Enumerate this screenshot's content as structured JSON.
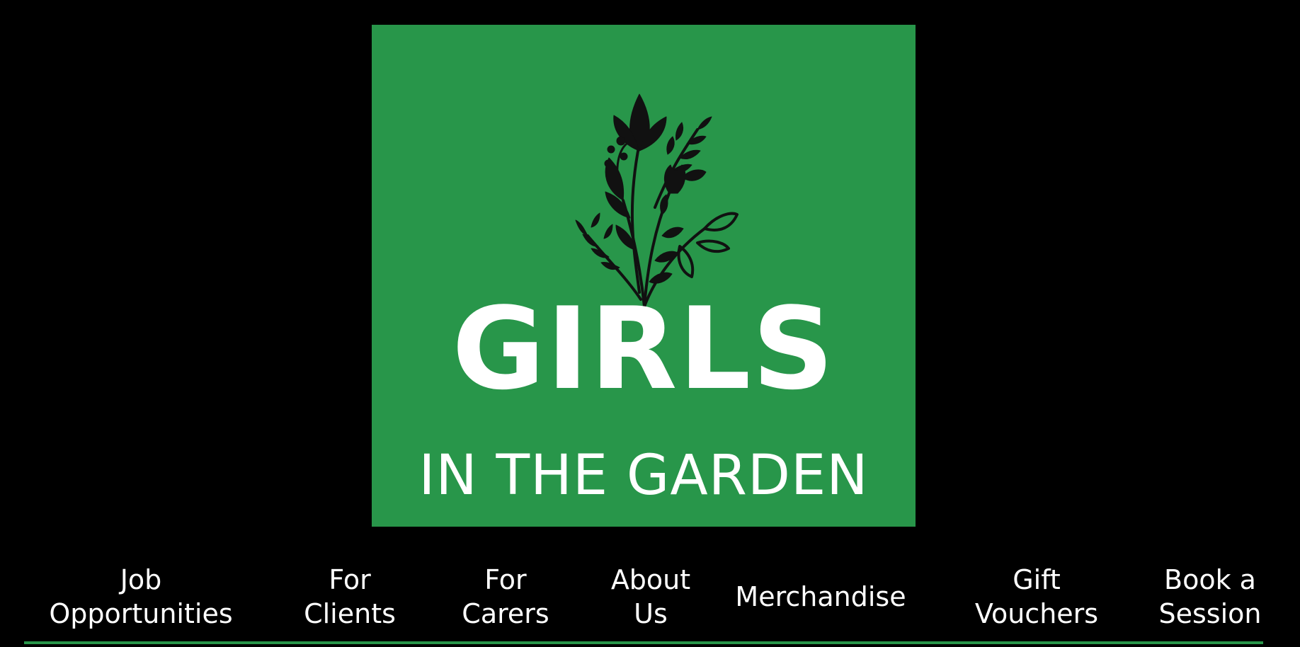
{
  "logo": {
    "title": "GIRLS",
    "subtitle": "IN THE GARDEN",
    "background_color": "#28964a",
    "icon": "plant-bouquet-icon"
  },
  "nav": {
    "items": [
      {
        "label": "Job\nOpportunities"
      },
      {
        "label": "For\nClients"
      },
      {
        "label": "For\nCarers"
      },
      {
        "label": "About\nUs"
      },
      {
        "label": "Merchandise"
      },
      {
        "label": "Gift\nVouchers"
      },
      {
        "label": "Book a\nSession"
      }
    ],
    "underline_color": "#28964a"
  }
}
